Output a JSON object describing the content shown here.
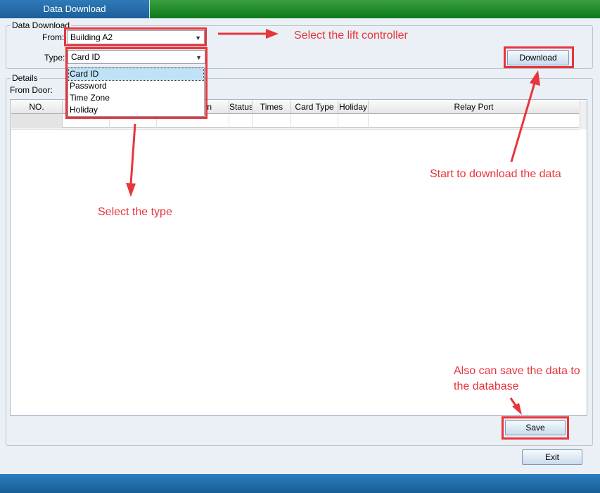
{
  "window": {
    "title": "Data Download"
  },
  "download_group": {
    "legend": "Data Download",
    "from_label": "From:",
    "from_value": "Building A2",
    "type_label": "Type:",
    "type_value": "Card ID",
    "type_options": [
      "Card ID",
      "Password",
      "Time Zone",
      "Holiday"
    ],
    "download_button": "Download"
  },
  "details_group": {
    "legend": "Details",
    "from_door_label": "From Door:",
    "columns": [
      "NO.",
      "",
      "",
      "n",
      "Status",
      "Times",
      "Card Type",
      "Holiday",
      "Relay Port"
    ]
  },
  "buttons": {
    "save": "Save",
    "exit": "Exit"
  },
  "annotations": {
    "lift_controller": "Select the lift controller",
    "select_type": "Select the type",
    "start_download": "Start to download the data",
    "save_line1": "Also can save the data to",
    "save_line2": "the database"
  },
  "colors": {
    "annotation": "#e8343b",
    "accent": "#1d5f9a"
  }
}
